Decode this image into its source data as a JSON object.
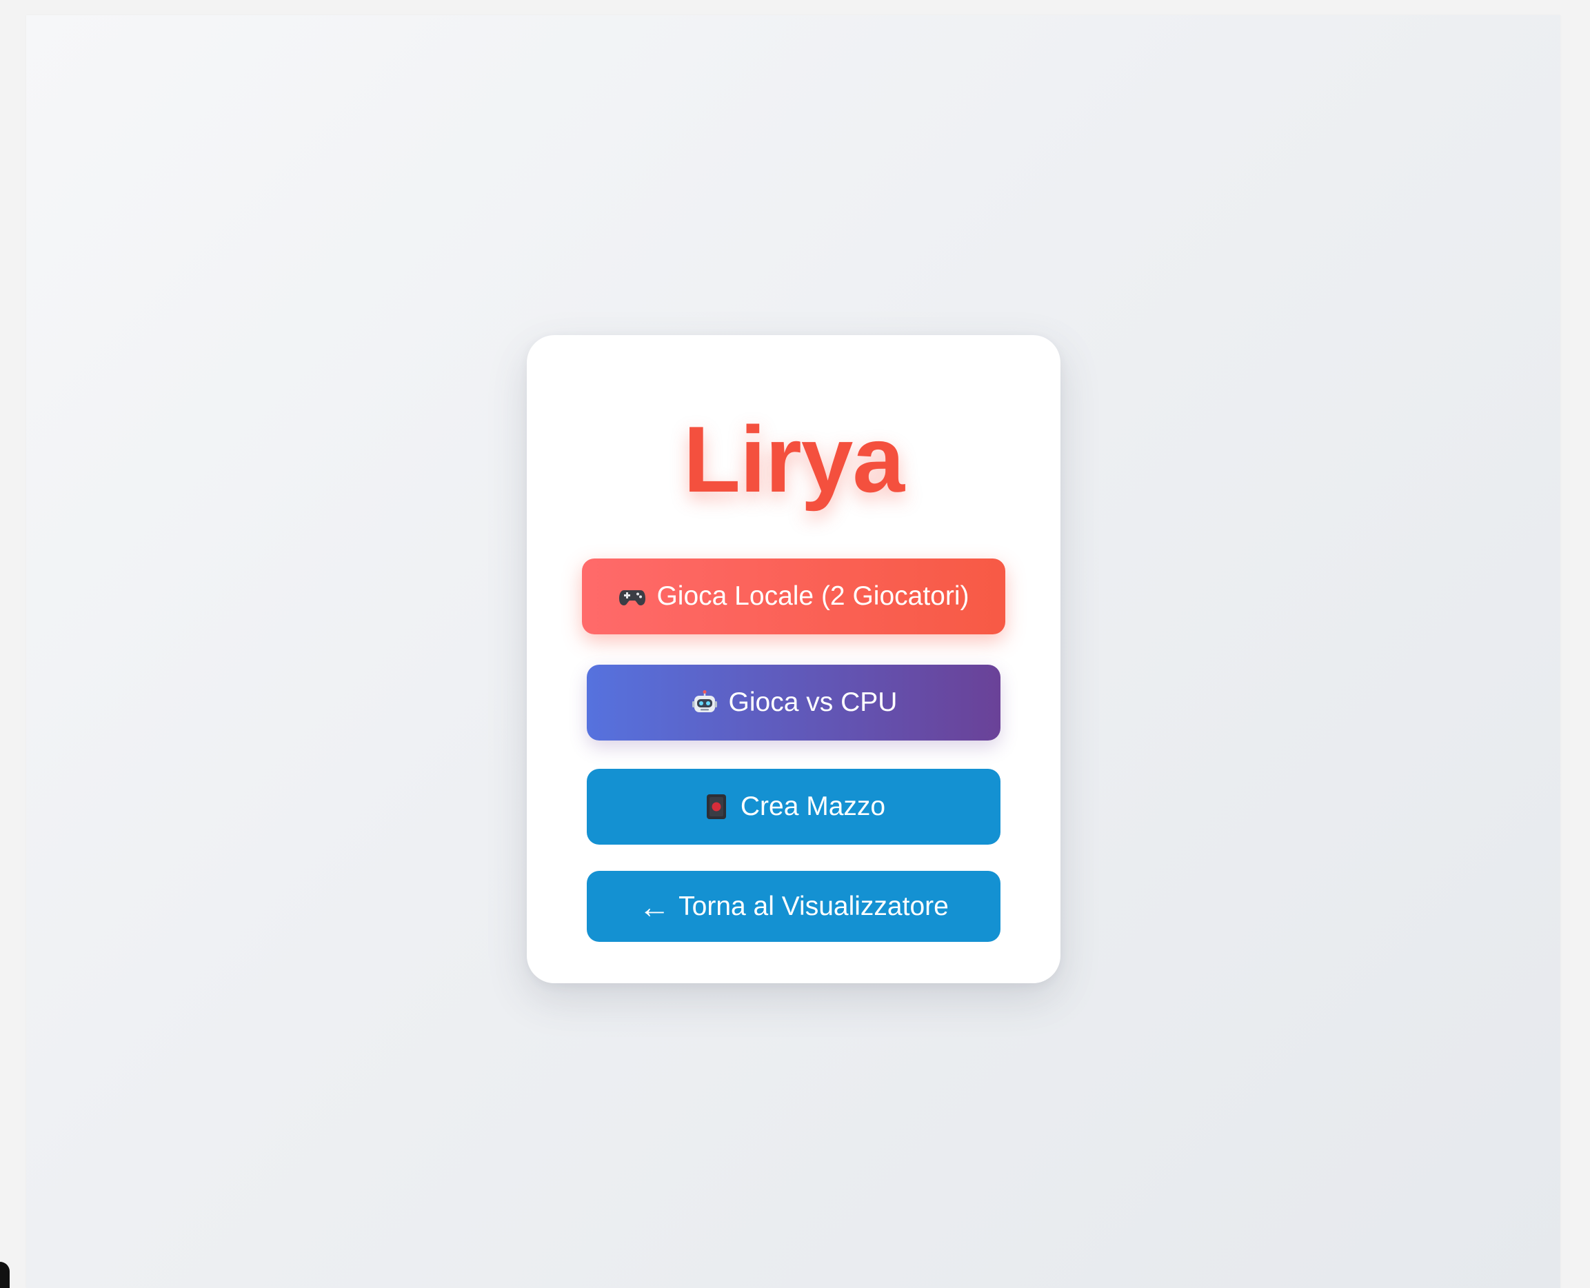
{
  "app": {
    "title": "Lirya"
  },
  "menu": {
    "local_label": "Gioca Locale (2 Giocatori)",
    "cpu_label": "Gioca vs CPU",
    "deck_label": "Crea Mazzo",
    "back_label": "Torna al Visualizzatore",
    "back_arrow": "←"
  },
  "icons": {
    "local": "gamepad-icon",
    "cpu": "robot-icon",
    "deck": "card-icon",
    "back": "arrow-left-icon"
  },
  "colors": {
    "title": "#f4503e",
    "local_start": "#ff6a6a",
    "local_end": "#f75a45",
    "cpu_start": "#5672de",
    "cpu_end": "#6a4298",
    "deck": "#1491d2",
    "back": "#1491d2"
  }
}
